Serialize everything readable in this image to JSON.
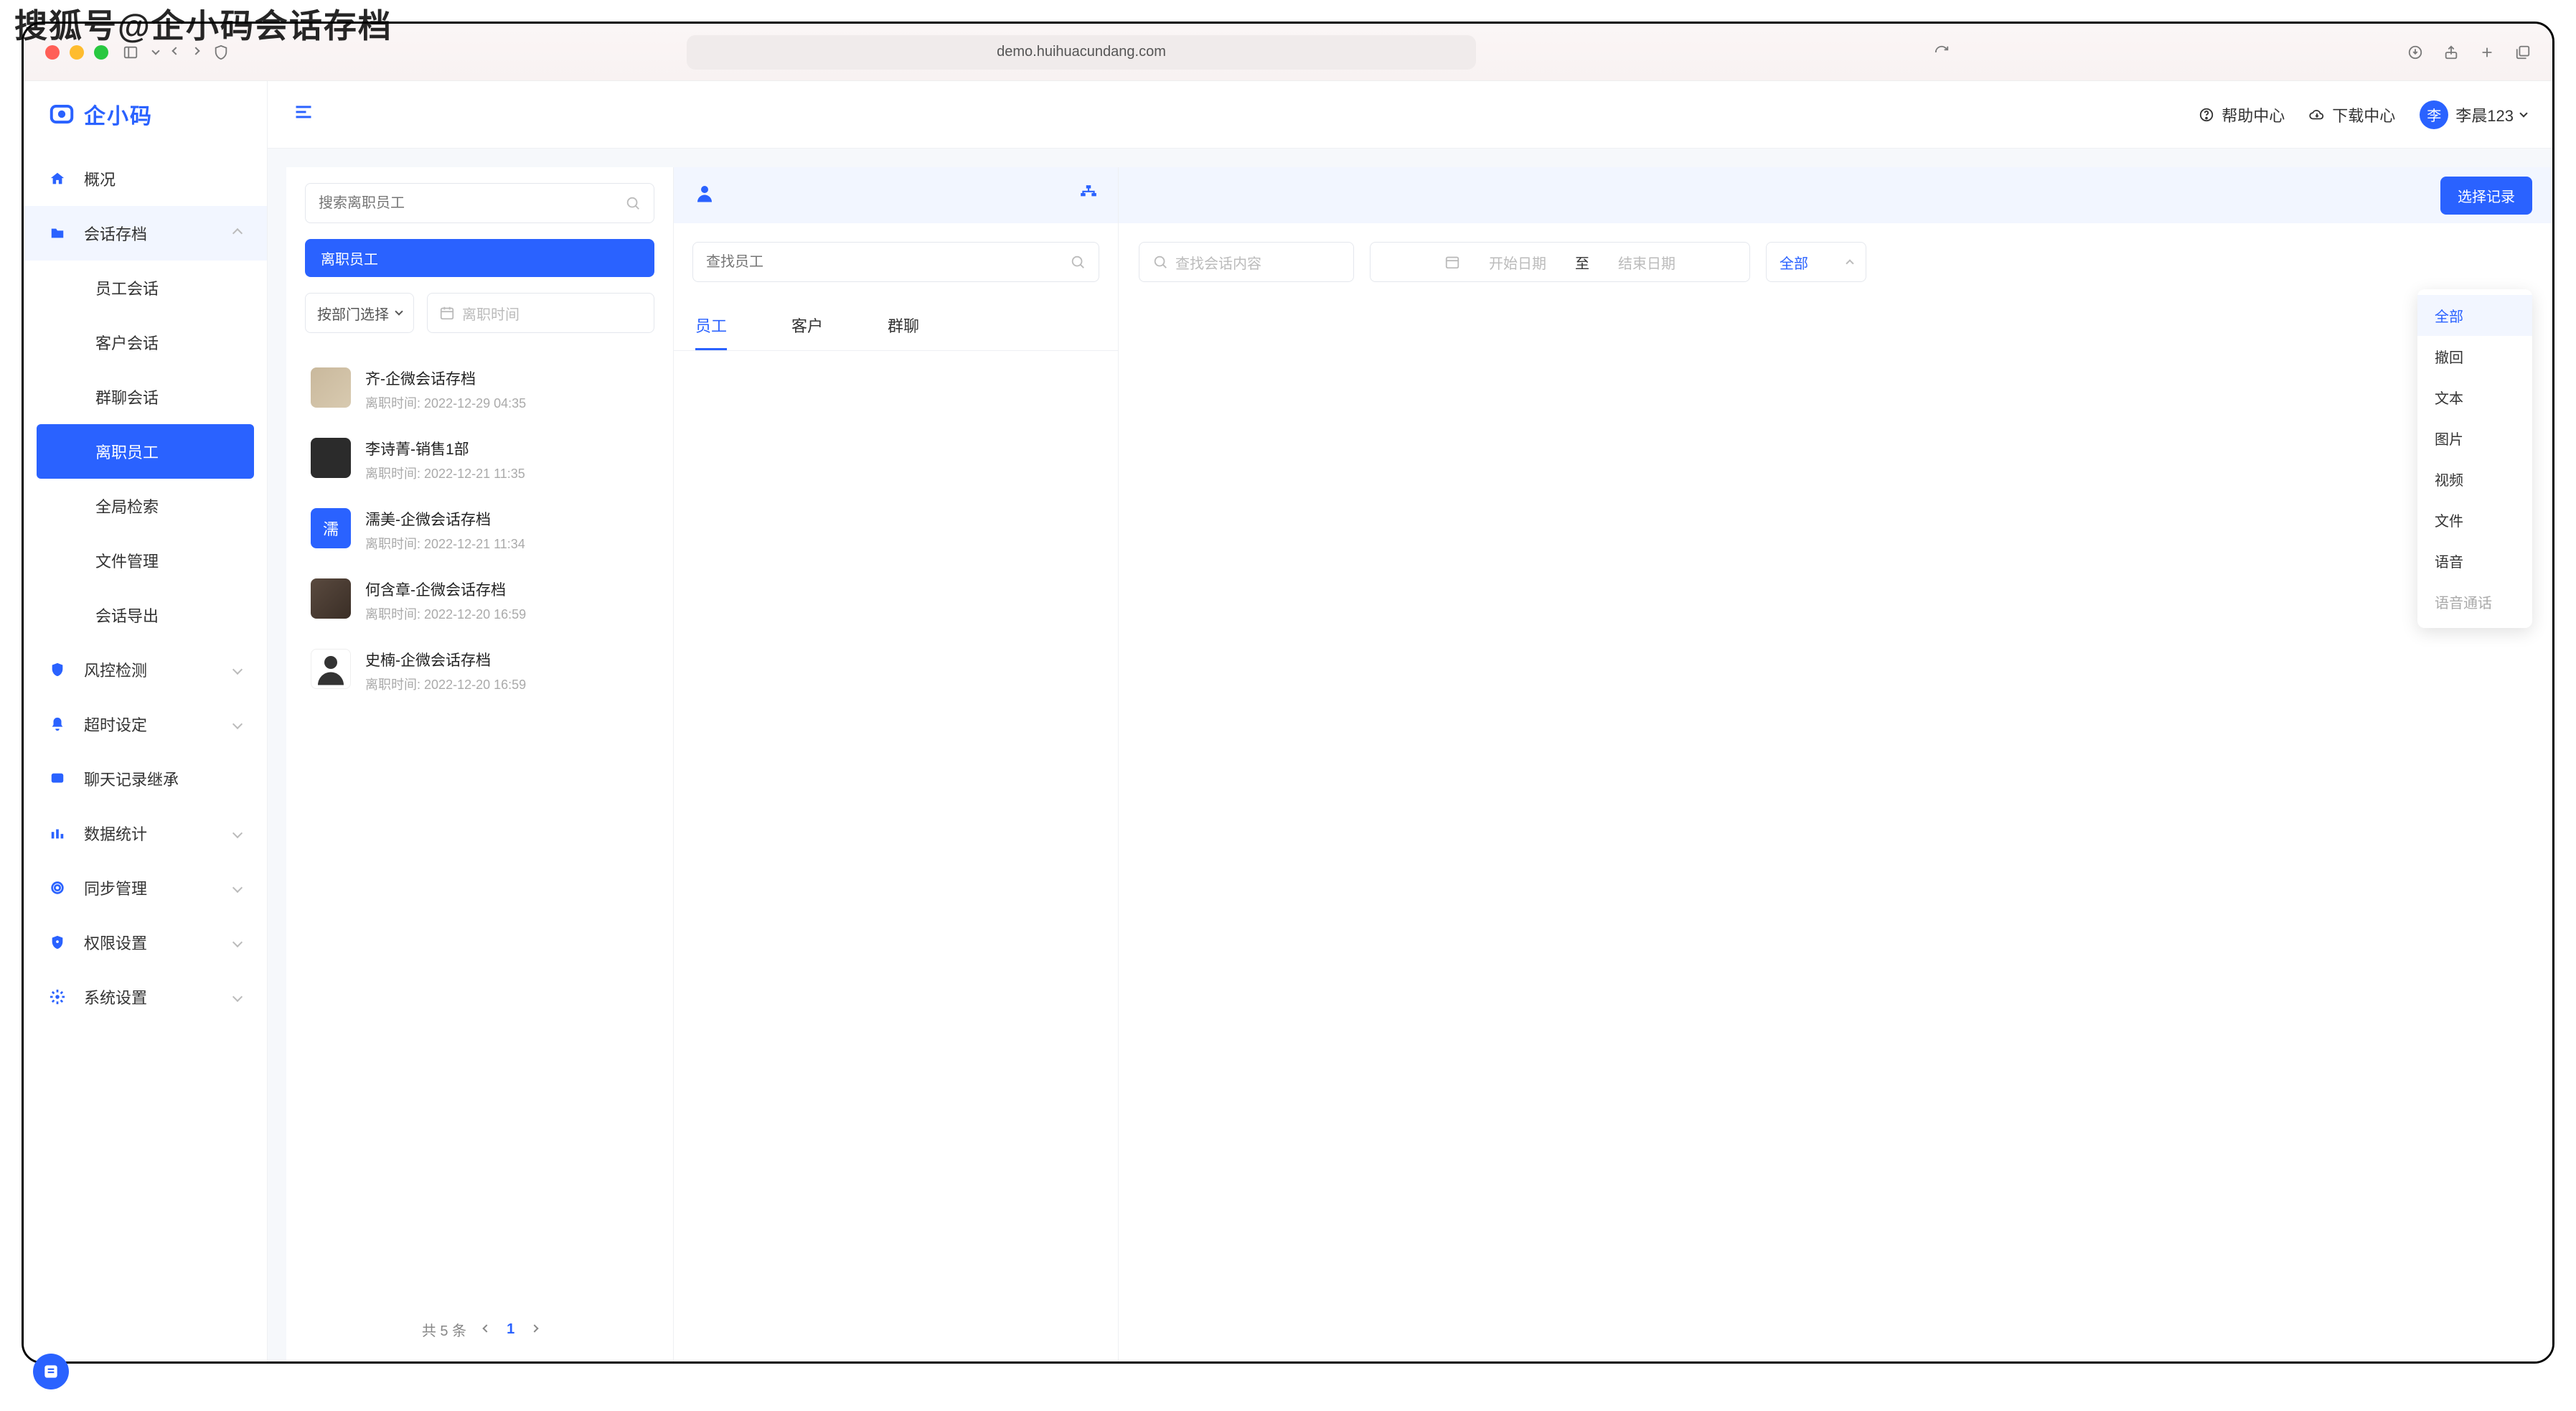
{
  "watermark": "搜狐号@企小码会话存档",
  "browser": {
    "url": "demo.huihuacundang.com"
  },
  "logo_text": "企小码",
  "header": {
    "help": "帮助中心",
    "download": "下载中心",
    "user_name": "李晨123",
    "user_initial": "李"
  },
  "sidebar": {
    "overview": "概况",
    "archive": "会话存档",
    "archive_children": {
      "emp": "员工会话",
      "cust": "客户会话",
      "group": "群聊会话",
      "left": "离职员工",
      "global": "全局检索",
      "files": "文件管理",
      "export": "会话导出"
    },
    "risk": "风控检测",
    "timeout": "超时设定",
    "inherit": "聊天记录继承",
    "stats": "数据统计",
    "sync": "同步管理",
    "perm": "权限设置",
    "system": "系统设置"
  },
  "col1": {
    "search_placeholder": "搜索离职员工",
    "tag": "离职员工",
    "dept_select": "按部门选择",
    "date_placeholder": "离职时间",
    "meta_label": "离职时间:",
    "employees": [
      {
        "name": "齐-企微会话存档",
        "time": "2022-12-29 04:35",
        "avatar": "gradient"
      },
      {
        "name": "李诗菁-销售1部",
        "time": "2022-12-21 11:35",
        "avatar": "dark"
      },
      {
        "name": "濡美-企微会话存档",
        "time": "2022-12-21 11:34",
        "avatar": "blue",
        "initial": "濡"
      },
      {
        "name": "何含章-企微会话存档",
        "time": "2022-12-20 16:59",
        "avatar": "warm"
      },
      {
        "name": "史楠-企微会话存档",
        "time": "2022-12-20 16:59",
        "avatar": "person"
      }
    ],
    "pagination": {
      "total": "共 5 条",
      "page": "1"
    }
  },
  "col2": {
    "search_placeholder": "查找员工",
    "tabs": {
      "emp": "员工",
      "cust": "客户",
      "group": "群聊"
    }
  },
  "col3": {
    "select_btn": "选择记录",
    "conv_search_placeholder": "查找会话内容",
    "date_start": "开始日期",
    "date_sep": "至",
    "date_end": "结束日期",
    "type_label": "全部",
    "dropdown": [
      "全部",
      "撤回",
      "文本",
      "图片",
      "视频",
      "文件",
      "语音",
      "语音通话"
    ]
  }
}
